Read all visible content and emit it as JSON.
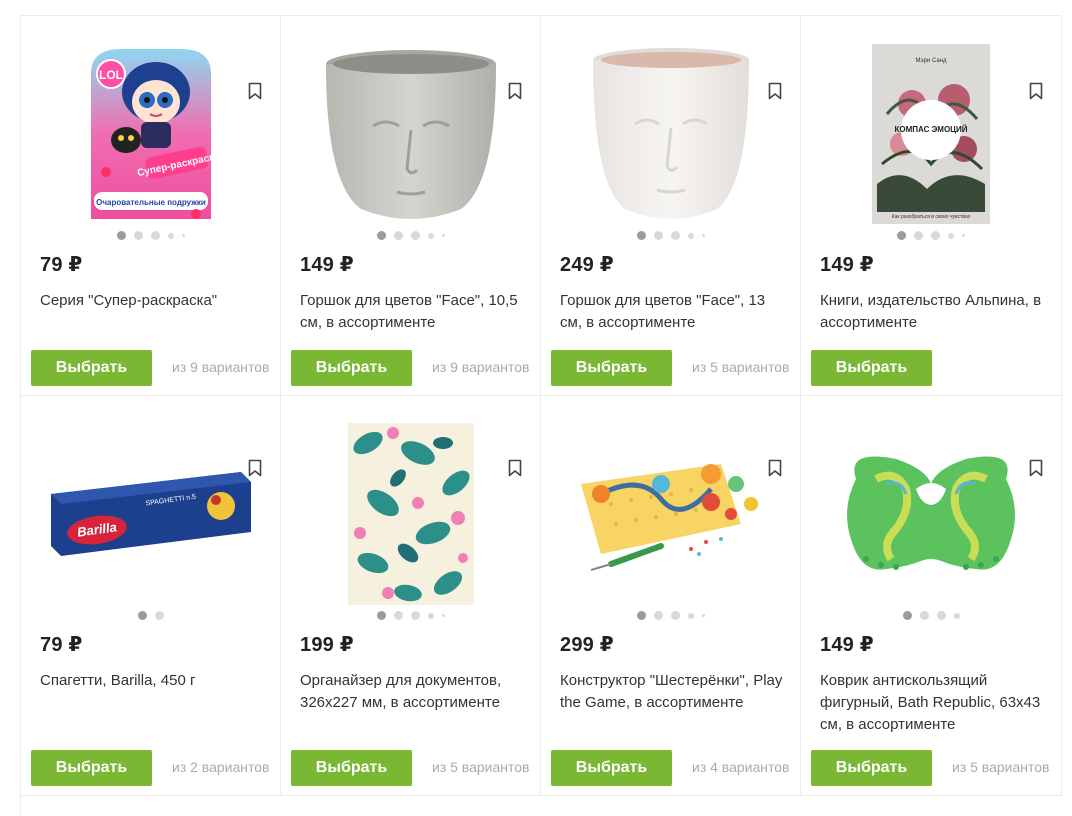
{
  "products": [
    {
      "price": "79 ₽",
      "title": "Серия \"Супер-раскраска\"",
      "button": "Выбрать",
      "variants": "из 9 вариантов",
      "dots": 5
    },
    {
      "price": "149 ₽",
      "title": "Горшок для цветов \"Face\", 10,5 см, в ассортименте",
      "button": "Выбрать",
      "variants": "из 9 вариантов",
      "dots": 5
    },
    {
      "price": "249 ₽",
      "title": "Горшок для цветов \"Face\", 13 см, в ассортименте",
      "button": "Выбрать",
      "variants": "из 5 вариантов",
      "dots": 5
    },
    {
      "price": "149 ₽",
      "title": "Книги, издательство Альпина, в ассортименте",
      "button": "Выбрать",
      "variants": "",
      "dots": 5
    },
    {
      "price": "79 ₽",
      "title": "Спагетти, Barilla, 450 г",
      "button": "Выбрать",
      "variants": "из 2 вариантов",
      "dots": 2
    },
    {
      "price": "199 ₽",
      "title": "Органайзер для документов, 326x227 мм, в ассортименте",
      "button": "Выбрать",
      "variants": "из 5 вариантов",
      "dots": 5
    },
    {
      "price": "299 ₽",
      "title": "Конструктор \"Шестерёнки\", Play the Game, в ассортименте",
      "button": "Выбрать",
      "variants": "из 4 вариантов",
      "dots": 5
    },
    {
      "price": "149 ₽",
      "title": "Коврик антискользящий фигурный, Bath Republic, 63x43 см, в ассортименте",
      "button": "Выбрать",
      "variants": "из 5 вариантов",
      "dots": 4
    }
  ],
  "images": {
    "coloring": {
      "brand": "LOL",
      "title": "Супер-раскраска",
      "subtitle": "Очаровательные подружки"
    },
    "book": {
      "author": "Мэри Санд",
      "title": "КОМПАС ЭМОЦИЙ",
      "tagline": "Как разобраться в своих чувствах"
    },
    "pasta": {
      "brand": "Barilla",
      "name": "SPAGHETTI n.5"
    }
  },
  "colors": {
    "accent": "#7ab733",
    "price": "#222222",
    "muted": "#aaaaaa"
  }
}
